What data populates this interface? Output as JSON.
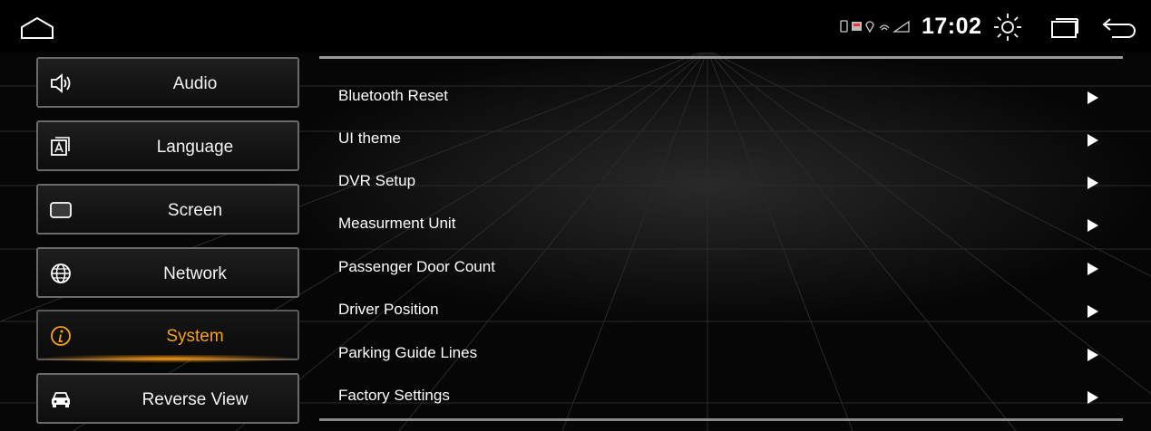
{
  "status_bar": {
    "time": "17:02",
    "icons": [
      "home-icon",
      "sim-icon",
      "photo-icon",
      "location-icon",
      "wifi-icon",
      "signal-icon",
      "brightness-icon",
      "recents-icon",
      "back-icon"
    ]
  },
  "sidebar": {
    "active_color": "#f5a21a",
    "items": [
      {
        "label": "Audio",
        "icon": "speaker-icon",
        "active": false
      },
      {
        "label": "Language",
        "icon": "language-icon",
        "active": false
      },
      {
        "label": "Screen",
        "icon": "screen-icon",
        "active": false
      },
      {
        "label": "Network",
        "icon": "globe-icon",
        "active": false
      },
      {
        "label": "System",
        "icon": "info-icon",
        "active": true
      },
      {
        "label": "Reverse View",
        "icon": "car-icon",
        "active": false
      }
    ]
  },
  "settings": {
    "items": [
      {
        "label": "Bluetooth Reset"
      },
      {
        "label": "UI theme"
      },
      {
        "label": "DVR Setup"
      },
      {
        "label": "Measurment Unit"
      },
      {
        "label": "Passenger Door Count"
      },
      {
        "label": "Driver Position"
      },
      {
        "label": "Parking Guide Lines"
      },
      {
        "label": "Factory Settings"
      }
    ]
  }
}
